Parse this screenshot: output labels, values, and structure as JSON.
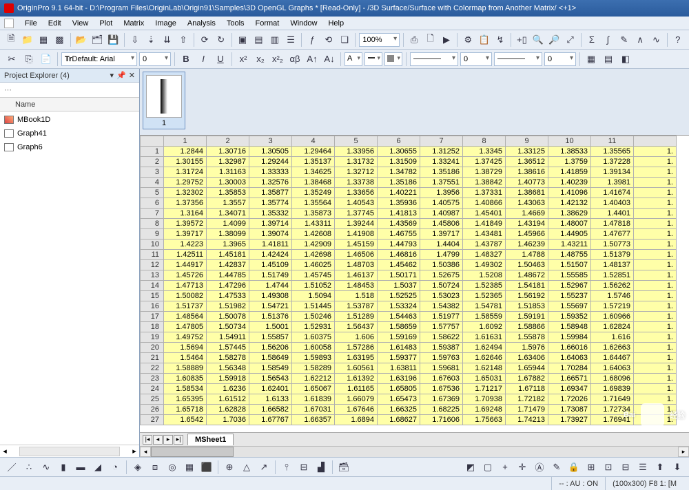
{
  "title": "OriginPro 9.1 64-bit - D:\\Program Files\\OriginLab\\Origin91\\Samples\\3D OpenGL Graphs * [Read-Only] - /3D Surface/Surface with Colormap from Another Matrix/ <+1>",
  "menu": [
    "File",
    "Edit",
    "View",
    "Plot",
    "Matrix",
    "Image",
    "Analysis",
    "Tools",
    "Format",
    "Window",
    "Help"
  ],
  "font": {
    "label": "Default: Arial",
    "size": "0"
  },
  "zoom": "100%",
  "lineWidth": "0",
  "lineWidth2": "0",
  "projectExplorer": {
    "title": "Project Explorer (4)",
    "colHeader": "Name",
    "items": [
      {
        "name": "MBook1D",
        "type": "mx"
      },
      {
        "name": "Graph41",
        "type": "g"
      },
      {
        "name": "Graph6",
        "type": "g"
      }
    ]
  },
  "thumb": {
    "label": "1"
  },
  "sheetTab": "MSheet1",
  "columns": [
    "1",
    "2",
    "3",
    "4",
    "5",
    "6",
    "7",
    "8",
    "9",
    "10",
    "11",
    ""
  ],
  "rows": [
    [
      "1.2844",
      "1.30716",
      "1.30505",
      "1.29464",
      "1.33956",
      "1.30655",
      "1.31252",
      "1.3345",
      "1.33125",
      "1.38533",
      "1.35565",
      "1."
    ],
    [
      "1.30155",
      "1.32987",
      "1.29244",
      "1.35137",
      "1.31732",
      "1.31509",
      "1.33241",
      "1.37425",
      "1.36512",
      "1.3759",
      "1.37228",
      "1."
    ],
    [
      "1.31724",
      "1.31163",
      "1.33333",
      "1.34625",
      "1.32712",
      "1.34782",
      "1.35186",
      "1.38729",
      "1.38616",
      "1.41859",
      "1.39134",
      "1."
    ],
    [
      "1.29752",
      "1.30003",
      "1.32576",
      "1.38468",
      "1.33738",
      "1.35186",
      "1.37551",
      "1.38842",
      "1.40773",
      "1.40239",
      "1.3981",
      "1."
    ],
    [
      "1.32302",
      "1.35853",
      "1.35877",
      "1.35249",
      "1.33656",
      "1.40221",
      "1.3956",
      "1.37331",
      "1.38681",
      "1.41096",
      "1.41674",
      "1."
    ],
    [
      "1.37356",
      "1.3557",
      "1.35774",
      "1.35564",
      "1.40543",
      "1.35936",
      "1.40575",
      "1.40866",
      "1.43063",
      "1.42132",
      "1.40403",
      "1."
    ],
    [
      "1.3164",
      "1.34071",
      "1.35332",
      "1.35873",
      "1.37745",
      "1.41813",
      "1.40987",
      "1.45401",
      "1.4669",
      "1.38629",
      "1.4401",
      "1."
    ],
    [
      "1.39572",
      "1.4099",
      "1.39714",
      "1.43311",
      "1.39244",
      "1.43569",
      "1.45806",
      "1.41849",
      "1.43194",
      "1.48007",
      "1.47818",
      "1."
    ],
    [
      "1.39717",
      "1.38099",
      "1.39074",
      "1.42608",
      "1.41908",
      "1.46755",
      "1.39717",
      "1.43481",
      "1.45966",
      "1.44905",
      "1.47677",
      "1."
    ],
    [
      "1.4223",
      "1.3965",
      "1.41811",
      "1.42909",
      "1.45159",
      "1.44793",
      "1.4404",
      "1.43787",
      "1.46239",
      "1.43211",
      "1.50773",
      "1."
    ],
    [
      "1.42511",
      "1.45181",
      "1.42424",
      "1.42698",
      "1.46506",
      "1.46816",
      "1.4799",
      "1.48327",
      "1.4788",
      "1.48755",
      "1.51379",
      "1."
    ],
    [
      "1.44917",
      "1.42837",
      "1.45109",
      "1.46025",
      "1.48703",
      "1.45462",
      "1.50386",
      "1.49302",
      "1.50463",
      "1.51507",
      "1.48137",
      "1."
    ],
    [
      "1.45726",
      "1.44785",
      "1.51749",
      "1.45745",
      "1.46137",
      "1.50171",
      "1.52675",
      "1.5208",
      "1.48672",
      "1.55585",
      "1.52851",
      "1."
    ],
    [
      "1.47713",
      "1.47296",
      "1.4744",
      "1.51052",
      "1.48453",
      "1.5037",
      "1.50724",
      "1.52385",
      "1.54181",
      "1.52967",
      "1.56262",
      "1."
    ],
    [
      "1.50082",
      "1.47533",
      "1.49308",
      "1.5094",
      "1.518",
      "1.52525",
      "1.53023",
      "1.52365",
      "1.56192",
      "1.55237",
      "1.5746",
      "1."
    ],
    [
      "1.51737",
      "1.51982",
      "1.54721",
      "1.51445",
      "1.53787",
      "1.53324",
      "1.54382",
      "1.54781",
      "1.51853",
      "1.55697",
      "1.57219",
      "1."
    ],
    [
      "1.48564",
      "1.50078",
      "1.51376",
      "1.50246",
      "1.51289",
      "1.54463",
      "1.51977",
      "1.58559",
      "1.59191",
      "1.59352",
      "1.60966",
      "1."
    ],
    [
      "1.47805",
      "1.50734",
      "1.5001",
      "1.52931",
      "1.56437",
      "1.58659",
      "1.57757",
      "1.6092",
      "1.58866",
      "1.58948",
      "1.62824",
      "1."
    ],
    [
      "1.49752",
      "1.54911",
      "1.55857",
      "1.60375",
      "1.606",
      "1.59169",
      "1.58622",
      "1.61631",
      "1.55878",
      "1.59984",
      "1.616",
      "1."
    ],
    [
      "1.5694",
      "1.57445",
      "1.56206",
      "1.60058",
      "1.57286",
      "1.61483",
      "1.59387",
      "1.62494",
      "1.5976",
      "1.66016",
      "1.62663",
      "1."
    ],
    [
      "1.5464",
      "1.58278",
      "1.58649",
      "1.59893",
      "1.63195",
      "1.59377",
      "1.59763",
      "1.62646",
      "1.63406",
      "1.64063",
      "1.64467",
      "1."
    ],
    [
      "1.58889",
      "1.56348",
      "1.58549",
      "1.58289",
      "1.60561",
      "1.63811",
      "1.59681",
      "1.62148",
      "1.65944",
      "1.70284",
      "1.64063",
      "1."
    ],
    [
      "1.60835",
      "1.59918",
      "1.56543",
      "1.62212",
      "1.61392",
      "1.63196",
      "1.67603",
      "1.65031",
      "1.67882",
      "1.66571",
      "1.68096",
      "1."
    ],
    [
      "1.58534",
      "1.6236",
      "1.62401",
      "1.65067",
      "1.61165",
      "1.65805",
      "1.67536",
      "1.71217",
      "1.67118",
      "1.69347",
      "1.69839",
      "1."
    ],
    [
      "1.65395",
      "1.61512",
      "1.6133",
      "1.61839",
      "1.66079",
      "1.65473",
      "1.67369",
      "1.70938",
      "1.72182",
      "1.72026",
      "1.71649",
      "1."
    ],
    [
      "1.65718",
      "1.62828",
      "1.66582",
      "1.67031",
      "1.67646",
      "1.66325",
      "1.68225",
      "1.69248",
      "1.71479",
      "1.73087",
      "1.72734",
      "1."
    ],
    [
      "1.6542",
      "1.7036",
      "1.67767",
      "1.66357",
      "1.6894",
      "1.68627",
      "1.71606",
      "1.75663",
      "1.74213",
      "1.73927",
      "1.76941",
      "1."
    ]
  ],
  "status": {
    "au": "-- : AU : ON",
    "dim": "(100x300) F8  1: [M"
  },
  "watermark": "经验"
}
